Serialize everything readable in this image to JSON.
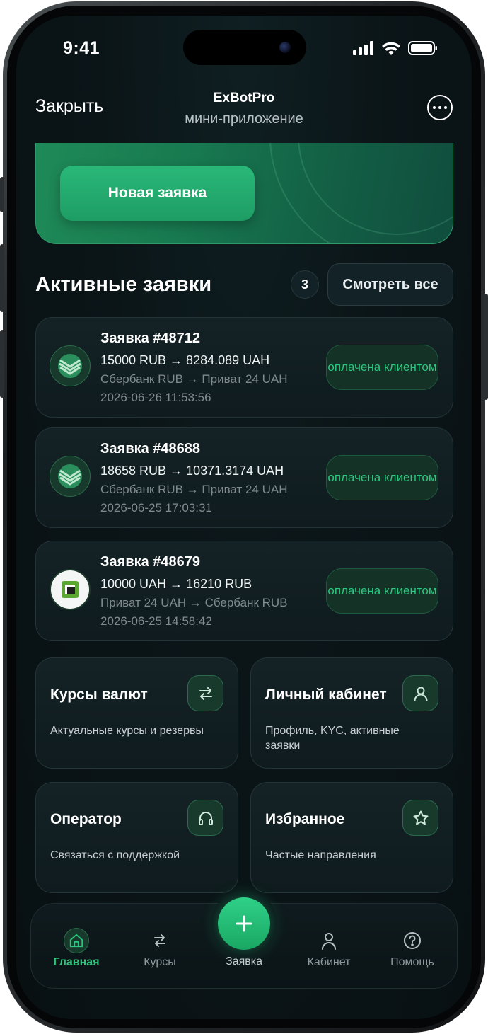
{
  "status_bar": {
    "time": "9:41"
  },
  "header": {
    "close_label": "Закрыть",
    "title": "ExBotPro",
    "subtitle": "мини-приложение"
  },
  "hero": {
    "button_label": "Новая заявка"
  },
  "active_orders": {
    "title": "Активные заявки",
    "count": "3",
    "view_all_label": "Смотреть все",
    "items": [
      {
        "id": "Заявка #48712",
        "amount": "15000 RUB → 8284.089 UAH",
        "route": "Сбербанк RUB → Приват 24 UAH",
        "date": "2026-06-26 11:53:56",
        "status": "оплачена клиентом",
        "icon": "sberbank-icon"
      },
      {
        "id": "Заявка #48688",
        "amount": "18658 RUB → 10371.3174 UAH",
        "route": "Сбербанк RUB → Приват 24 UAH",
        "date": "2026-06-25 17:03:31",
        "status": "оплачена клиентом",
        "icon": "sberbank-icon"
      },
      {
        "id": "Заявка #48679",
        "amount": "10000 UAH → 16210 RUB",
        "route": "Приват 24 UAH → Сбербанк RUB",
        "date": "2026-06-25 14:58:42",
        "status": "оплачена клиентом",
        "icon": "privat24-icon"
      }
    ]
  },
  "tiles": [
    {
      "title": "Курсы валют",
      "desc": "Актуальные курсы и резервы",
      "icon": "exchange-icon"
    },
    {
      "title": "Личный кабинет",
      "desc": "Профиль, KYC, активные заявки",
      "icon": "user-icon"
    },
    {
      "title": "Оператор",
      "desc": "Связаться с поддержкой",
      "icon": "headset-icon"
    },
    {
      "title": "Избранное",
      "desc": "Частые направления",
      "icon": "star-icon"
    }
  ],
  "tabbar": {
    "items": [
      {
        "label": "Главная",
        "icon": "home-icon",
        "active": true
      },
      {
        "label": "Курсы",
        "icon": "exchange-icon"
      },
      {
        "label": "Заявка",
        "icon": "plus-icon"
      },
      {
        "label": "Кабинет",
        "icon": "user-icon"
      },
      {
        "label": "Помощь",
        "icon": "help-icon"
      }
    ]
  },
  "colors": {
    "accent": "#2bc77f",
    "background": "#0b1518",
    "card": "#142226"
  }
}
